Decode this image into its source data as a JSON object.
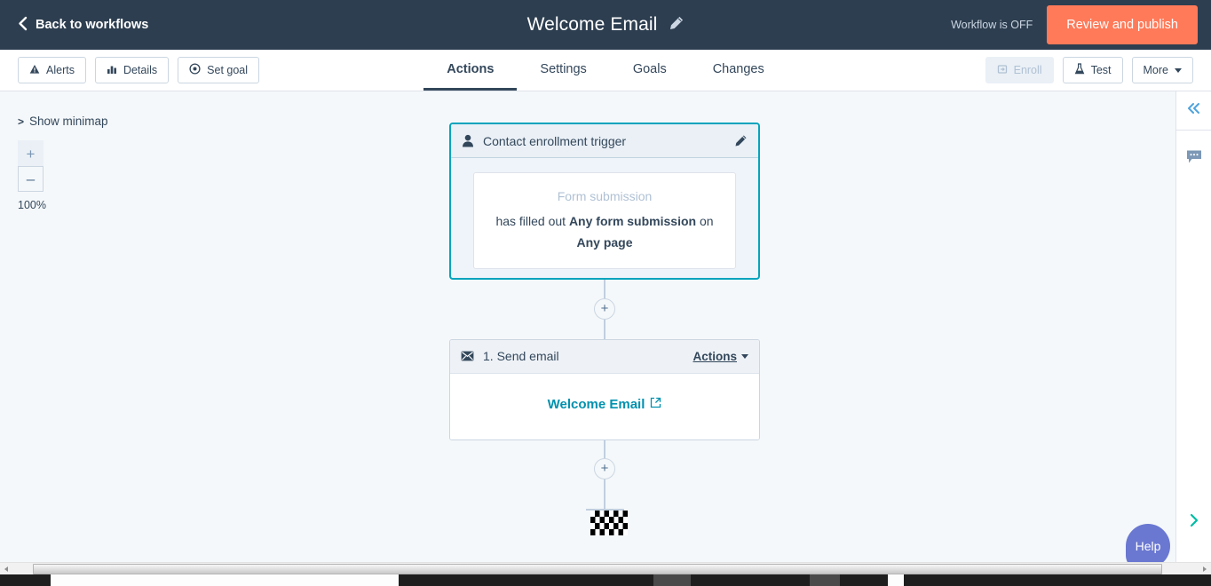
{
  "topnav": {
    "back_label": "Back to workflows",
    "back_icon": "chevron-left-icon",
    "title": "Welcome Email",
    "edit_icon": "pencil-icon",
    "status_text": "Workflow is OFF",
    "publish_label": "Review and publish",
    "publish_color": "#ff7a59",
    "bg_color": "#2d3e50"
  },
  "toolbar": {
    "left_buttons": [
      {
        "label": "Alerts",
        "icon": "alert-triangle-icon",
        "disabled": false
      },
      {
        "label": "Details",
        "icon": "bar-chart-icon",
        "disabled": false
      },
      {
        "label": "Set goal",
        "icon": "target-icon",
        "disabled": false
      }
    ],
    "right_buttons": [
      {
        "label": "Enroll",
        "icon": "enroll-icon",
        "disabled": true
      },
      {
        "label": "Test",
        "icon": "flask-icon",
        "disabled": false
      },
      {
        "label": "More",
        "icon": "caret-down-icon",
        "disabled": false
      }
    ],
    "tabs": [
      {
        "label": "Actions",
        "active": true
      },
      {
        "label": "Settings",
        "active": false
      },
      {
        "label": "Goals",
        "active": false
      },
      {
        "label": "Changes",
        "active": false
      }
    ],
    "active_tab_underline_color": "#33475b"
  },
  "canvas": {
    "minimap_label": "Show minimap",
    "minimap_chevron": ">",
    "zoom_in_label": "+",
    "zoom_out_label": "–",
    "zoom_level": "100%",
    "background_color": "#f5f8fa"
  },
  "flow": {
    "trigger": {
      "icon": "contact-person-icon",
      "title": "Contact enrollment trigger",
      "edit_icon": "pencil-icon",
      "border_color": "#00a4bd",
      "filter_label": "Form submission",
      "filter_text_prefix": "has filled out ",
      "filter_bold_1": "Any form submission",
      "filter_text_mid": " on ",
      "filter_bold_2": "Any page"
    },
    "plus_1": "+",
    "email_action": {
      "icon": "envelope-icon",
      "title": "1. Send email",
      "actions_label": "Actions",
      "actions_caret": "caret-down-icon",
      "email_name": "Welcome Email",
      "external_icon": "external-link-icon",
      "link_color": "#0091ae"
    },
    "plus_2": "+",
    "end_marker": "checkered-flag-icon"
  },
  "rail": {
    "collapse_icon": "double-chevron-left-icon",
    "comment_icon": "comment-bubble-icon",
    "expand_icon": "chevron-right-icon"
  },
  "help": {
    "label": "Help",
    "color": "#6a78d1"
  },
  "scrollbar": {
    "left_arrow": "scroll-left-arrow-icon",
    "right_arrow": "scroll-right-arrow-icon"
  }
}
